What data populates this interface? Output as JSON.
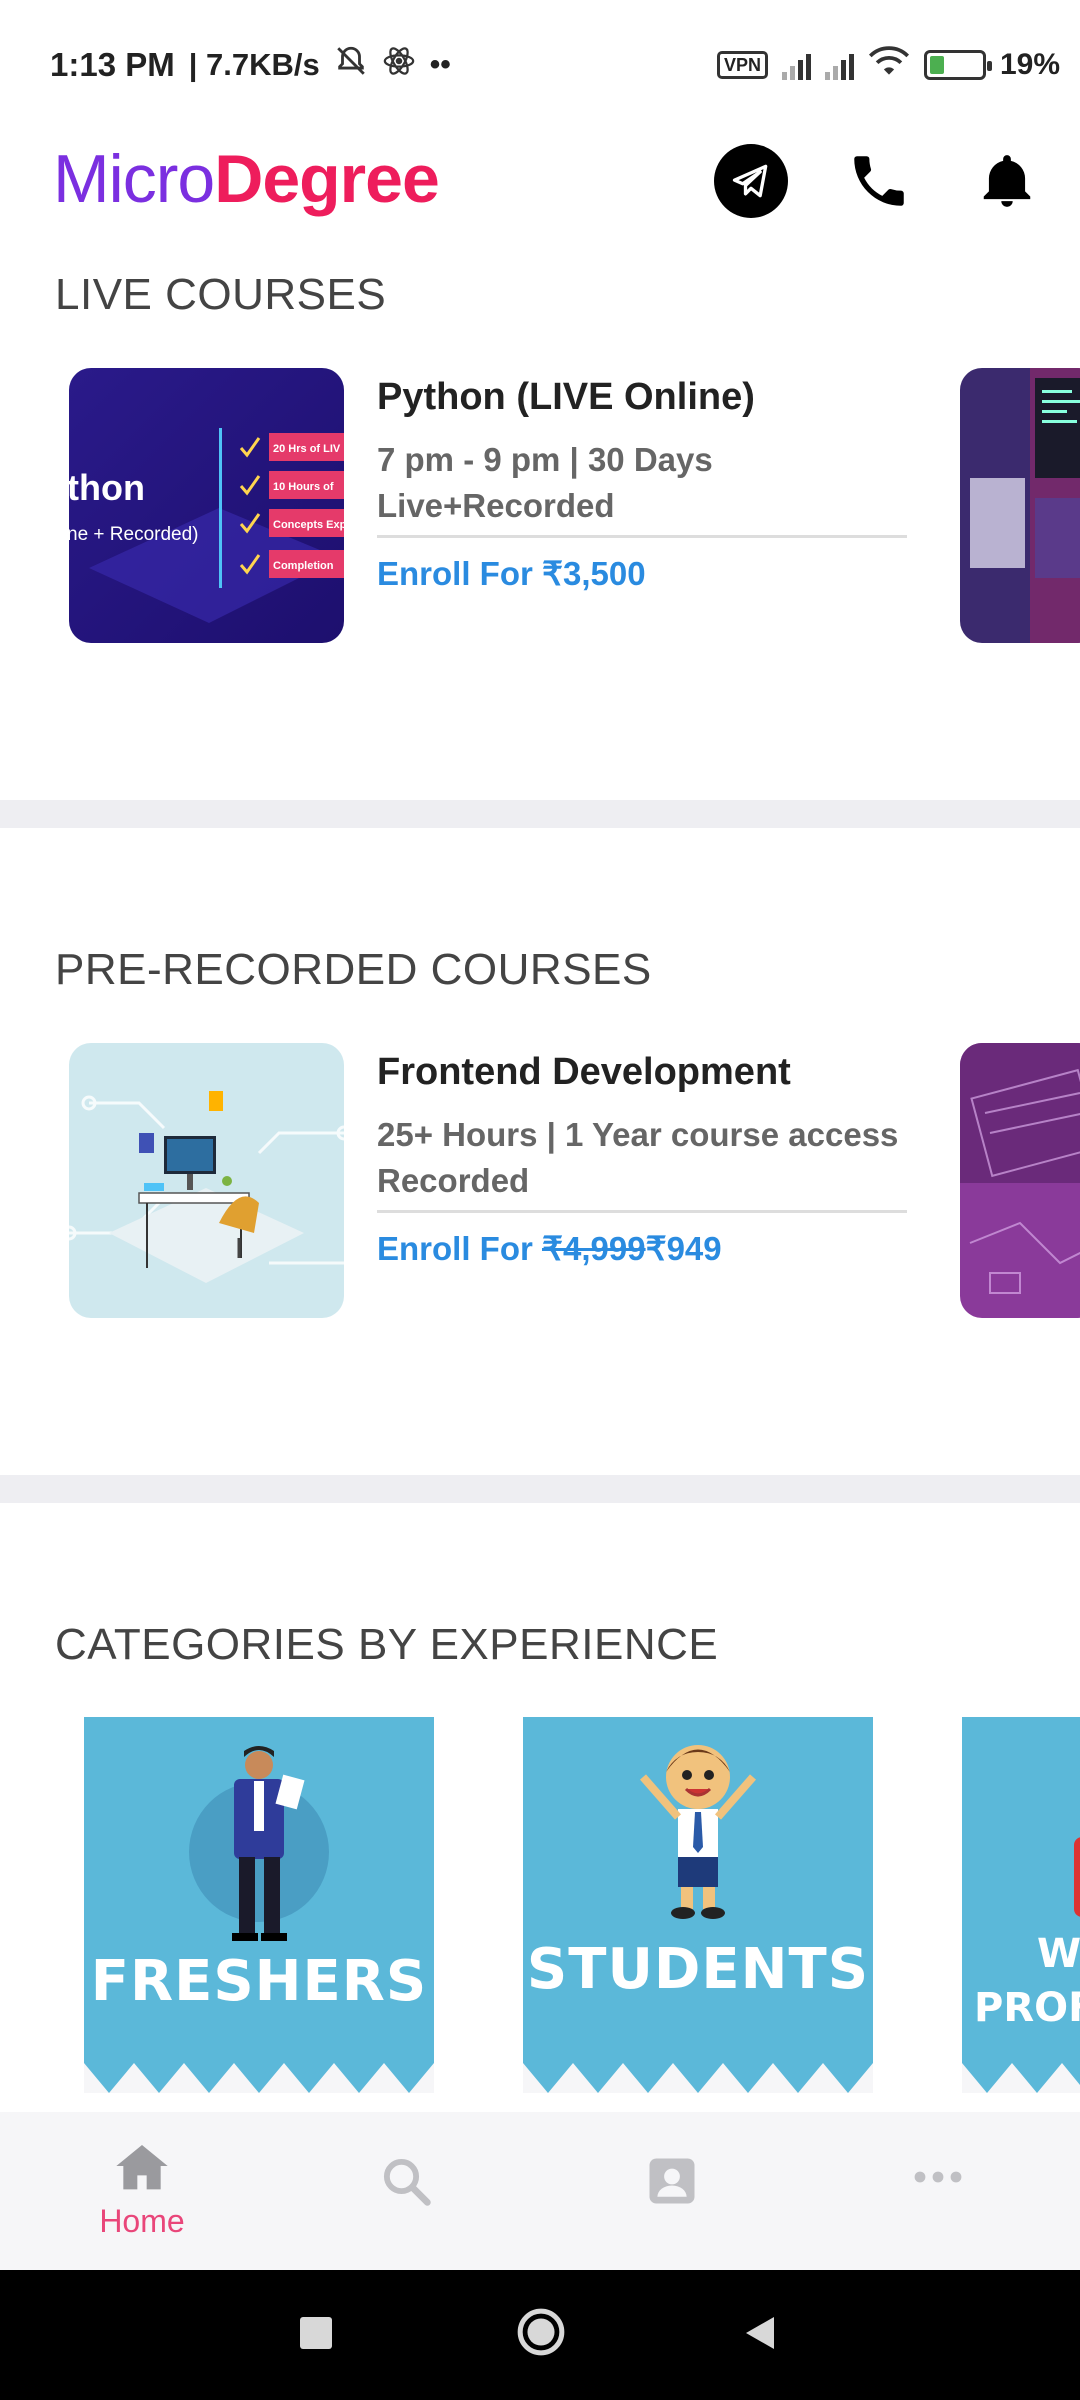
{
  "status_bar": {
    "time": "1:13 PM",
    "speed": "| 7.7KB/s",
    "vpn": "VPN",
    "battery": "19%"
  },
  "header": {
    "logo_micro": "Micro",
    "logo_degree": "Degree"
  },
  "live": {
    "section_title": "LIVE COURSES",
    "thumb_title": "thon",
    "thumb_sub": "ne + Recorded)",
    "thumb_points": [
      "20 Hrs of LIV",
      "10 Hours of",
      "Concepts Exp",
      "Completion"
    ],
    "course": {
      "title": "Python (LIVE Online)",
      "meta_line1": "7 pm - 9 pm | 30 Days",
      "meta_line2": "Live+Recorded",
      "price_prefix": "Enroll For ",
      "price": "₹3,500"
    }
  },
  "recorded": {
    "section_title": "PRE-RECORDED COURSES",
    "course": {
      "title": "Frontend Development",
      "meta_line1": "25+ Hours | 1 Year course access",
      "meta_line2": "Recorded",
      "price_prefix": "Enroll For ",
      "old_price": "₹4,999",
      "price": "₹949"
    }
  },
  "categories": {
    "section_title": "CATEGORIES BY EXPERIENCE",
    "items": [
      {
        "label": "FRESHERS"
      },
      {
        "label": "STUDENTS"
      },
      {
        "label_line1": "WO",
        "label_line2": "PROF"
      }
    ]
  },
  "bottom_nav": {
    "home_label": "Home"
  },
  "colors": {
    "brand_purple": "#7b2fe0",
    "brand_pink": "#ee1d5c",
    "link_blue": "#2a8be0",
    "category_blue": "#5bb8d9",
    "nav_active": "#e9467a"
  }
}
